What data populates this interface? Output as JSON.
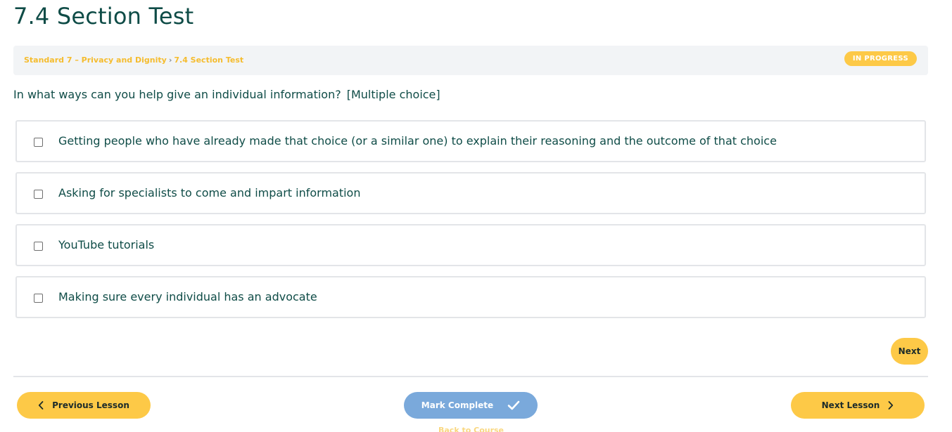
{
  "page": {
    "title": "7.4 Section Test"
  },
  "breadcrumb": {
    "items": [
      "Standard 7 – Privacy and Dignity",
      "7.4 Section Test"
    ],
    "separator": "›"
  },
  "status": {
    "label": "IN PROGRESS",
    "color": "#fdc947"
  },
  "question": {
    "text": "In what ways can you help give an individual information?",
    "type": "[Multiple choice]"
  },
  "answers": [
    {
      "label": "Getting people who have already made that choice (or a similar one) to explain their reasoning and the outcome of that choice",
      "checked": false
    },
    {
      "label": "Asking for specialists to come and impart information",
      "checked": false
    },
    {
      "label": "YouTube tutorials",
      "checked": false
    },
    {
      "label": "Making sure every individual has an advocate",
      "checked": false
    }
  ],
  "quiz_nav": {
    "next_label": "Next"
  },
  "lesson_nav": {
    "previous_label": "Previous Lesson",
    "mark_complete_label": "Mark Complete",
    "next_label": "Next Lesson",
    "back_label": "Back to Course"
  },
  "colors": {
    "accent": "#fdc947",
    "text": "#0f4c47",
    "complete_button": "#7aa9db"
  },
  "icons": {
    "previous": "chevron-left-icon",
    "next": "chevron-right-icon",
    "complete": "check-icon"
  }
}
